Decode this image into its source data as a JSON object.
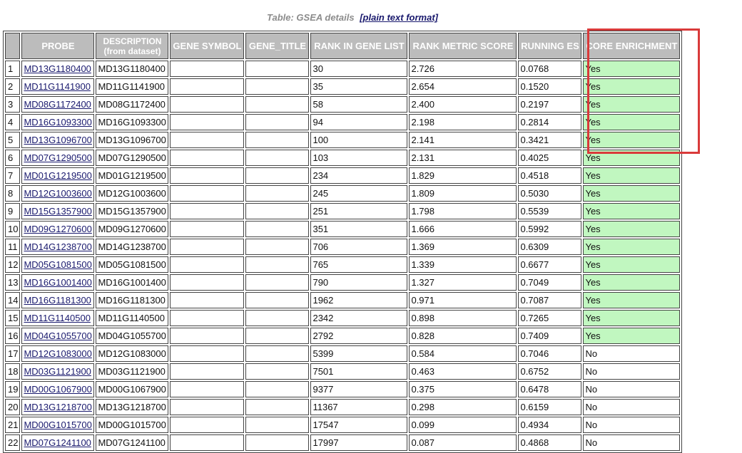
{
  "caption": {
    "text": "Table: GSEA details",
    "link_label": "[plain text format]"
  },
  "columns": {
    "index": "",
    "probe": "PROBE",
    "description_line1": "DESCRIPTION",
    "description_line2": "(from dataset)",
    "gene_symbol": "GENE SYMBOL",
    "gene_title": "GENE_TITLE",
    "rank_in_gene_list": "RANK IN GENE LIST",
    "rank_metric_score": "RANK METRIC SCORE",
    "running_es": "RUNNING ES",
    "core_enrichment": "CORE ENRICHMENT"
  },
  "rows": [
    {
      "idx": "1",
      "probe": "MD13G1180400",
      "desc": "MD13G1180400",
      "symbol": "",
      "title": "",
      "rank": "30",
      "score": "2.726",
      "es": "0.0768",
      "core": "Yes"
    },
    {
      "idx": "2",
      "probe": "MD11G1141900",
      "desc": "MD11G1141900",
      "symbol": "",
      "title": "",
      "rank": "35",
      "score": "2.654",
      "es": "0.1520",
      "core": "Yes"
    },
    {
      "idx": "3",
      "probe": "MD08G1172400",
      "desc": "MD08G1172400",
      "symbol": "",
      "title": "",
      "rank": "58",
      "score": "2.400",
      "es": "0.2197",
      "core": "Yes"
    },
    {
      "idx": "4",
      "probe": "MD16G1093300",
      "desc": "MD16G1093300",
      "symbol": "",
      "title": "",
      "rank": "94",
      "score": "2.198",
      "es": "0.2814",
      "core": "Yes"
    },
    {
      "idx": "5",
      "probe": "MD13G1096700",
      "desc": "MD13G1096700",
      "symbol": "",
      "title": "",
      "rank": "100",
      "score": "2.141",
      "es": "0.3421",
      "core": "Yes"
    },
    {
      "idx": "6",
      "probe": "MD07G1290500",
      "desc": "MD07G1290500",
      "symbol": "",
      "title": "",
      "rank": "103",
      "score": "2.131",
      "es": "0.4025",
      "core": "Yes"
    },
    {
      "idx": "7",
      "probe": "MD01G1219500",
      "desc": "MD01G1219500",
      "symbol": "",
      "title": "",
      "rank": "234",
      "score": "1.829",
      "es": "0.4518",
      "core": "Yes"
    },
    {
      "idx": "8",
      "probe": "MD12G1003600",
      "desc": "MD12G1003600",
      "symbol": "",
      "title": "",
      "rank": "245",
      "score": "1.809",
      "es": "0.5030",
      "core": "Yes"
    },
    {
      "idx": "9",
      "probe": "MD15G1357900",
      "desc": "MD15G1357900",
      "symbol": "",
      "title": "",
      "rank": "251",
      "score": "1.798",
      "es": "0.5539",
      "core": "Yes"
    },
    {
      "idx": "10",
      "probe": "MD09G1270600",
      "desc": "MD09G1270600",
      "symbol": "",
      "title": "",
      "rank": "351",
      "score": "1.666",
      "es": "0.5992",
      "core": "Yes"
    },
    {
      "idx": "11",
      "probe": "MD14G1238700",
      "desc": "MD14G1238700",
      "symbol": "",
      "title": "",
      "rank": "706",
      "score": "1.369",
      "es": "0.6309",
      "core": "Yes"
    },
    {
      "idx": "12",
      "probe": "MD05G1081500",
      "desc": "MD05G1081500",
      "symbol": "",
      "title": "",
      "rank": "765",
      "score": "1.339",
      "es": "0.6677",
      "core": "Yes"
    },
    {
      "idx": "13",
      "probe": "MD16G1001400",
      "desc": "MD16G1001400",
      "symbol": "",
      "title": "",
      "rank": "790",
      "score": "1.327",
      "es": "0.7049",
      "core": "Yes"
    },
    {
      "idx": "14",
      "probe": "MD16G1181300",
      "desc": "MD16G1181300",
      "symbol": "",
      "title": "",
      "rank": "1962",
      "score": "0.971",
      "es": "0.7087",
      "core": "Yes"
    },
    {
      "idx": "15",
      "probe": "MD11G1140500",
      "desc": "MD11G1140500",
      "symbol": "",
      "title": "",
      "rank": "2342",
      "score": "0.898",
      "es": "0.7265",
      "core": "Yes"
    },
    {
      "idx": "16",
      "probe": "MD04G1055700",
      "desc": "MD04G1055700",
      "symbol": "",
      "title": "",
      "rank": "2792",
      "score": "0.828",
      "es": "0.7409",
      "core": "Yes"
    },
    {
      "idx": "17",
      "probe": "MD12G1083000",
      "desc": "MD12G1083000",
      "symbol": "",
      "title": "",
      "rank": "5399",
      "score": "0.584",
      "es": "0.7046",
      "core": "No"
    },
    {
      "idx": "18",
      "probe": "MD03G1121900",
      "desc": "MD03G1121900",
      "symbol": "",
      "title": "",
      "rank": "7501",
      "score": "0.463",
      "es": "0.6752",
      "core": "No"
    },
    {
      "idx": "19",
      "probe": "MD00G1067900",
      "desc": "MD00G1067900",
      "symbol": "",
      "title": "",
      "rank": "9377",
      "score": "0.375",
      "es": "0.6478",
      "core": "No"
    },
    {
      "idx": "20",
      "probe": "MD13G1218700",
      "desc": "MD13G1218700",
      "symbol": "",
      "title": "",
      "rank": "11367",
      "score": "0.298",
      "es": "0.6159",
      "core": "No"
    },
    {
      "idx": "21",
      "probe": "MD00G1015700",
      "desc": "MD00G1015700",
      "symbol": "",
      "title": "",
      "rank": "17547",
      "score": "0.099",
      "es": "0.4934",
      "core": "No"
    },
    {
      "idx": "22",
      "probe": "MD07G1241100",
      "desc": "MD07G1241100",
      "symbol": "",
      "title": "",
      "rank": "17997",
      "score": "0.087",
      "es": "0.4868",
      "core": "No"
    }
  ],
  "colors": {
    "header_bg": "#bcbcbc",
    "core_yes_bg": "#c1f7c0",
    "highlight_border": "#d93a3a",
    "link": "#1a1a6e"
  }
}
